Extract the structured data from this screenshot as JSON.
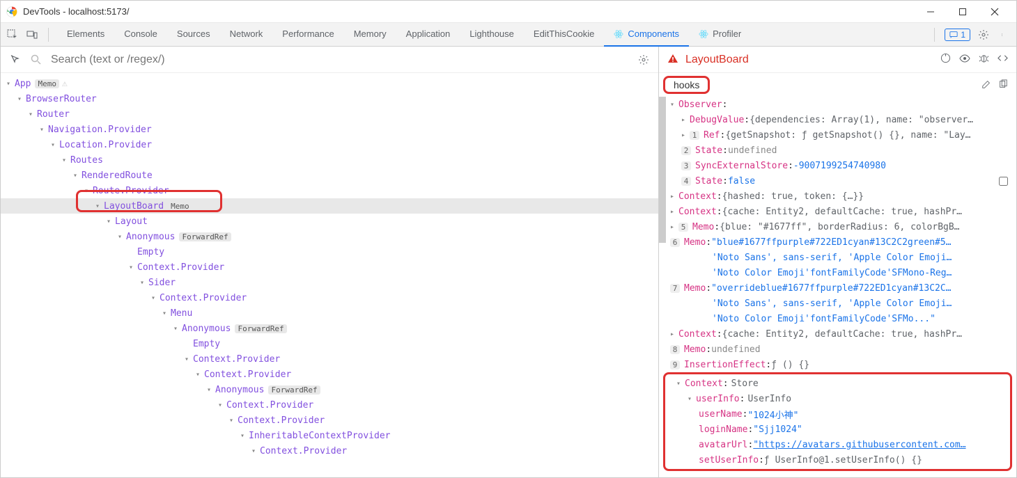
{
  "window": {
    "title": "DevTools - localhost:5173/"
  },
  "toolbar": {
    "tabs": [
      "Elements",
      "Console",
      "Sources",
      "Network",
      "Performance",
      "Memory",
      "Application",
      "Lighthouse",
      "EditThisCookie",
      "Components",
      "Profiler"
    ],
    "activeTab": "Components",
    "reactTabs": [
      "Components",
      "Profiler"
    ],
    "msgCount": "1"
  },
  "search": {
    "placeholder": "Search (text or /regex/)"
  },
  "tree": [
    {
      "depth": 0,
      "label": "App",
      "badge": "Memo",
      "warn": true
    },
    {
      "depth": 1,
      "label": "BrowserRouter"
    },
    {
      "depth": 2,
      "label": "Router"
    },
    {
      "depth": 3,
      "label": "Navigation.Provider"
    },
    {
      "depth": 4,
      "label": "Location.Provider"
    },
    {
      "depth": 5,
      "label": "Routes"
    },
    {
      "depth": 6,
      "label": "RenderedRoute"
    },
    {
      "depth": 7,
      "label": "Route.Provider"
    },
    {
      "depth": 8,
      "label": "LayoutBoard",
      "badge": "Memo",
      "selected": true
    },
    {
      "depth": 9,
      "label": "Layout"
    },
    {
      "depth": 10,
      "label": "Anonymous",
      "badge": "ForwardRef"
    },
    {
      "depth": 11,
      "label": "Empty",
      "leaf": true
    },
    {
      "depth": 11,
      "label": "Context.Provider"
    },
    {
      "depth": 12,
      "label": "Sider"
    },
    {
      "depth": 13,
      "label": "Context.Provider"
    },
    {
      "depth": 14,
      "label": "Menu"
    },
    {
      "depth": 15,
      "label": "Anonymous",
      "badge": "ForwardRef"
    },
    {
      "depth": 16,
      "label": "Empty",
      "leaf": true
    },
    {
      "depth": 16,
      "label": "Context.Provider"
    },
    {
      "depth": 17,
      "label": "Context.Provider"
    },
    {
      "depth": 18,
      "label": "Anonymous",
      "badge": "ForwardRef"
    },
    {
      "depth": 19,
      "label": "Context.Provider"
    },
    {
      "depth": 20,
      "label": "Context.Provider"
    },
    {
      "depth": 21,
      "label": "InheritableContextProvider"
    },
    {
      "depth": 22,
      "label": "Context.Provider"
    }
  ],
  "rightHeader": {
    "title": "LayoutBoard"
  },
  "hooksLabel": "hooks",
  "props": [
    {
      "depth": 0,
      "caret": "down",
      "key": "Observer",
      "colon": ":"
    },
    {
      "depth": 1,
      "caret": "right",
      "key": "DebugValue",
      "colon": ": ",
      "valObj": "{dependencies: Array(1), name: \"observer…"
    },
    {
      "depth": 1,
      "caret": "right",
      "idx": "1",
      "key": "Ref",
      "colon": ": ",
      "valObj": "{getSnapshot: ƒ getSnapshot() {}, name: \"Lay…"
    },
    {
      "depth": 1,
      "idx": "2",
      "key": "State",
      "colon": ": ",
      "valUndef": "undefined"
    },
    {
      "depth": 1,
      "idx": "3",
      "key": "SyncExternalStore",
      "colon": ": ",
      "valNum": "-9007199254740980"
    },
    {
      "depth": 1,
      "idx": "4",
      "key": "State",
      "colon": ": ",
      "valBool": "false",
      "checkbox": true
    },
    {
      "depth": 0,
      "caret": "right",
      "key": "Context",
      "colon": ": ",
      "valObj": "{hashed: true, token: {…}}"
    },
    {
      "depth": 0,
      "caret": "right",
      "key": "Context",
      "colon": ": ",
      "valObj": "{cache: Entity2, defaultCache: true, hashPr…"
    },
    {
      "depth": 0,
      "caret": "right",
      "idx": "5",
      "key": "Memo",
      "colon": ": ",
      "valObj": "{blue: \"#1677ff\", borderRadius: 6, colorBgB…"
    },
    {
      "depth": 0,
      "idx": "6",
      "key": "Memo",
      "colon": ": ",
      "valStr": "\"blue#1677ffpurple#722ED1cyan#13C2C2green#5…"
    },
    {
      "depth": 0,
      "cont": true,
      "valStr": "'Noto Sans', sans-serif, 'Apple Color Emoji…"
    },
    {
      "depth": 0,
      "cont": true,
      "valStr": "'Noto Color Emoji'fontFamilyCode'SFMono-Reg…"
    },
    {
      "depth": 0,
      "idx": "7",
      "key": "Memo",
      "colon": ": ",
      "valStr": "\"overrideblue#1677ffpurple#722ED1cyan#13C2C…"
    },
    {
      "depth": 0,
      "cont": true,
      "valStr": "'Noto Sans', sans-serif, 'Apple Color Emoji…"
    },
    {
      "depth": 0,
      "cont": true,
      "valStr": "'Noto Color Emoji'fontFamilyCode'SFMo...\""
    },
    {
      "depth": 0,
      "caret": "right",
      "key": "Context",
      "colon": ": ",
      "valObj": "{cache: Entity2, defaultCache: true, hashPr…"
    },
    {
      "depth": 0,
      "idx": "8",
      "key": "Memo",
      "colon": ": ",
      "valUndef": "undefined"
    },
    {
      "depth": 0,
      "idx": "9",
      "key": "InsertionEffect",
      "colon": ": ",
      "valObj": "ƒ () {}"
    }
  ],
  "storeBox": {
    "header": {
      "caret": "down",
      "key": "Context",
      "colon": ": ",
      "valType": "Store"
    },
    "rows": [
      {
        "depth": 1,
        "caret": "down",
        "key": "userInfo",
        "colon": ": ",
        "valType": "UserInfo"
      },
      {
        "depth": 2,
        "key": "userName",
        "colon": ": ",
        "valStr": "\"1024小神\""
      },
      {
        "depth": 2,
        "key": "loginName",
        "colon": ": ",
        "valStr": "\"Sjj1024\""
      },
      {
        "depth": 2,
        "key": "avatarUrl",
        "colon": ": ",
        "valLink": "\"https://avatars.githubusercontent.com…"
      },
      {
        "depth": 2,
        "key": "setUserInfo",
        "colon": ": ",
        "valObj": "ƒ UserInfo@1.setUserInfo() {}"
      }
    ]
  }
}
